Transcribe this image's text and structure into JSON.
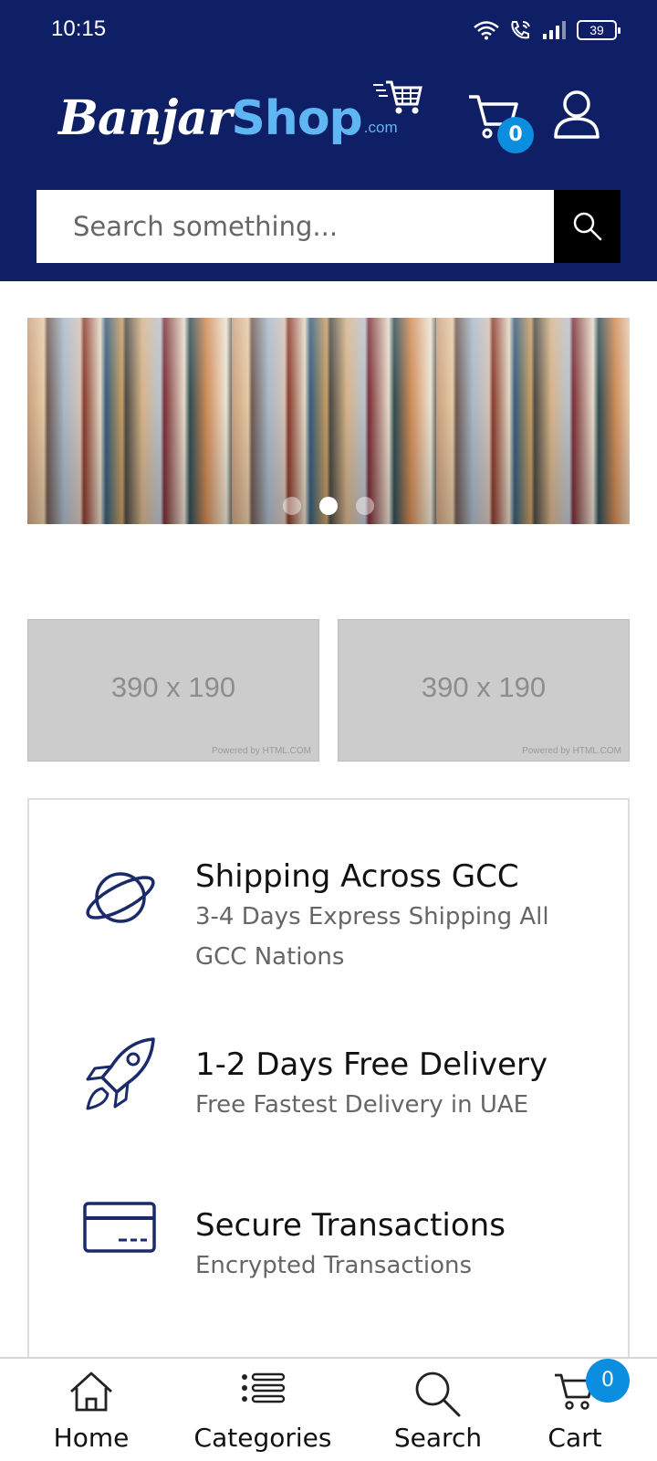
{
  "status_bar": {
    "time": "10:15",
    "battery": "39"
  },
  "header": {
    "logo": {
      "part1": "Banjar",
      "part2": "Shop",
      "suffix": ".com"
    },
    "cart_count": "0",
    "search": {
      "placeholder": "Search something..."
    }
  },
  "carousel": {
    "slide_count": 3,
    "active_index": 1
  },
  "promo_tiles": [
    {
      "size_text": "390 x 190",
      "credit": "Powered by HTML.COM"
    },
    {
      "size_text": "390 x 190",
      "credit": "Powered by HTML.COM"
    }
  ],
  "features": [
    {
      "icon": "planet-icon",
      "title": "Shipping Across GCC",
      "description": "3-4 Days Express Shipping All GCC Nations"
    },
    {
      "icon": "rocket-icon",
      "title": "1-2 Days Free Delivery",
      "description": "Free Fastest Delivery in UAE"
    },
    {
      "icon": "credit-card-icon",
      "title": "Secure Transactions",
      "description": "Encrypted Transactions"
    }
  ],
  "bottom_nav": {
    "items": [
      {
        "label": "Home",
        "icon": "home-icon"
      },
      {
        "label": "Categories",
        "icon": "list-icon"
      },
      {
        "label": "Search",
        "icon": "search-icon"
      },
      {
        "label": "Cart",
        "icon": "cart-icon"
      }
    ],
    "cart_badge": "0"
  },
  "colors": {
    "header_bg": "#0f1f66",
    "accent_blue": "#0b8ee0",
    "logo_light_blue": "#5fb6f2",
    "icon_navy": "#1b2a6b"
  }
}
